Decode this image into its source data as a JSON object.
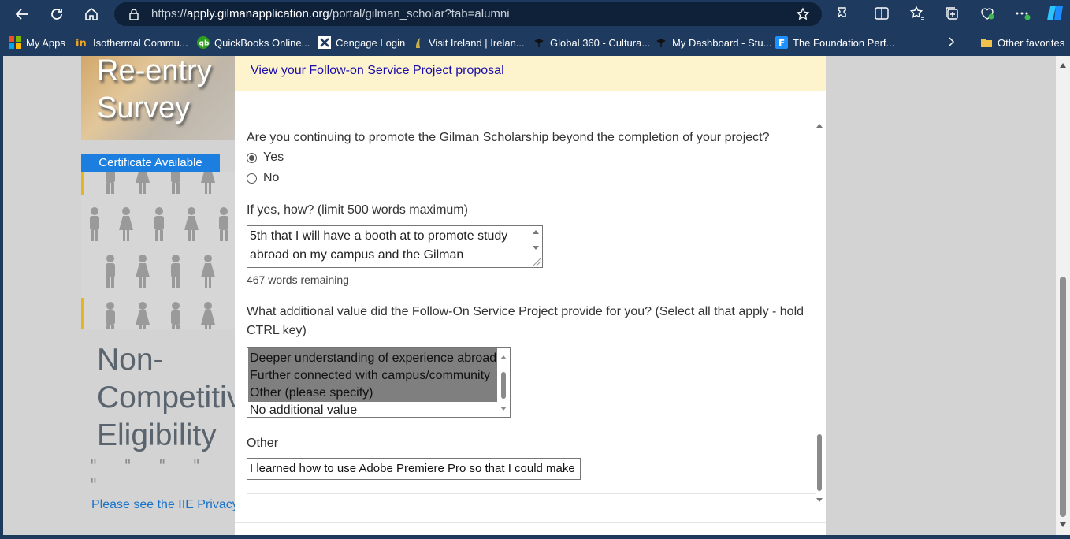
{
  "browser": {
    "url_prefix": "https://",
    "url_domain": "apply.gilmanapplication.org",
    "url_path": "/portal/gilman_scholar?tab=alumni",
    "bookmarks": [
      {
        "label": "My Apps",
        "icon": "ms-apps-icon"
      },
      {
        "label": "Isothermal Commu...",
        "icon": "isothermal-icon"
      },
      {
        "label": "QuickBooks Online...",
        "icon": "quickbooks-icon"
      },
      {
        "label": "Cengage Login",
        "icon": "cengage-icon"
      },
      {
        "label": "Visit Ireland | Irelan...",
        "icon": "ireland-icon"
      },
      {
        "label": "Global 360 - Cultura...",
        "icon": "global360-icon"
      },
      {
        "label": "My Dashboard - Stu...",
        "icon": "dashboard-icon"
      },
      {
        "label": "The Foundation Perf...",
        "icon": "foundation-icon"
      }
    ],
    "other_favorites": "Other favorites"
  },
  "sidebar": {
    "survey_line1": "Re-entry",
    "survey_line2": "Survey",
    "certificate": "Certificate Available",
    "noncomp_line1": "Non-",
    "noncomp_line2": "Competitive",
    "noncomp_line3": "Eligibility",
    "privacy": "Please see the IIE Privacy Statement"
  },
  "modal": {
    "proposal_link": "View your Follow-on Service Project proposal",
    "q_continue": "Are you continuing to promote the Gilman Scholarship beyond the completion of your project?",
    "opt_yes": "Yes",
    "opt_no": "No",
    "selected": "Yes",
    "q_how": "If yes, how? (limit 500 words maximum)",
    "how_value": "5th that I will have a booth at to promote study abroad on my campus and the Gilman",
    "words_remaining": "467 words remaining",
    "q_value_line1": "What additional value did the Follow-On Service Project provide for you? (Select all that apply - hold",
    "q_value_line2": "CTRL key)",
    "value_options": [
      {
        "label": "Deeper understanding of experience abroad",
        "selected": true
      },
      {
        "label": "Further connected with campus/community",
        "selected": true
      },
      {
        "label": "Other (please specify)",
        "selected": true
      },
      {
        "label": "No additional value",
        "selected": false
      }
    ],
    "other_label": "Other",
    "other_value": "I learned how to use Adobe Premiere Pro so that I could make"
  }
}
